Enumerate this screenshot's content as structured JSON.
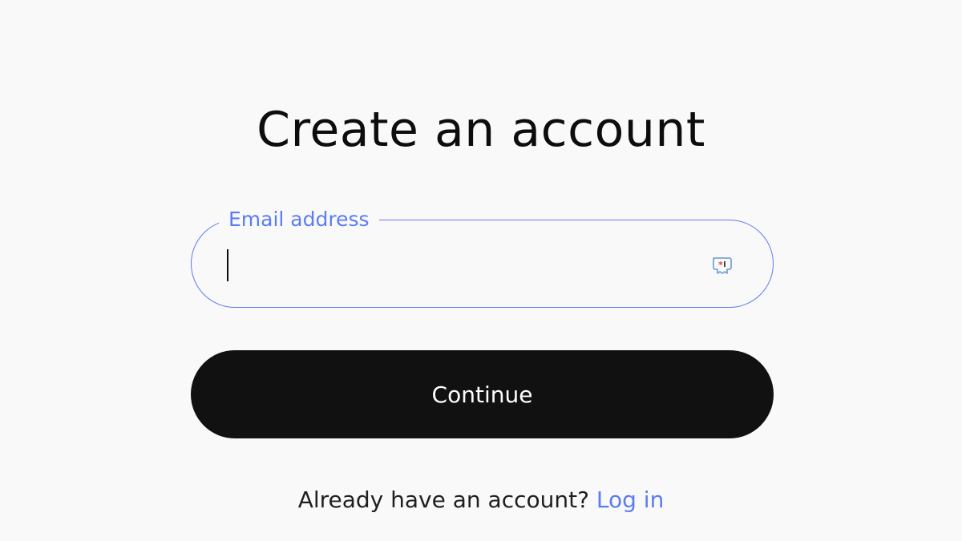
{
  "page": {
    "title": "Create an account"
  },
  "email": {
    "label": "Email address",
    "value": "",
    "placeholder": ""
  },
  "continue_button": {
    "label": "Continue"
  },
  "login": {
    "prompt": "Already have an account?",
    "link_label": "Log in"
  },
  "icons": {
    "password_manager": "password-manager-icon"
  },
  "colors": {
    "background": "#f9f9f9",
    "accent": "#5c7cf2",
    "button": "#111111",
    "button_text": "#ffffff",
    "text": "#0d0d0d"
  }
}
